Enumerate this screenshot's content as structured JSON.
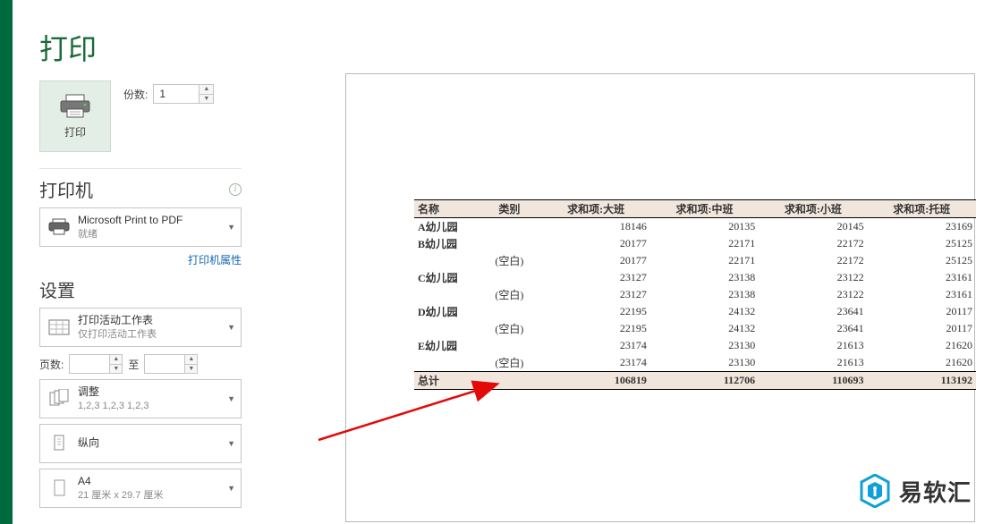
{
  "page": {
    "title": "打印"
  },
  "print_button": {
    "label": "打印"
  },
  "copies": {
    "label": "份数:",
    "value": "1"
  },
  "sections": {
    "printer": "打印机",
    "settings": "设置"
  },
  "printer": {
    "name": "Microsoft Print to PDF",
    "status": "就绪",
    "properties_link": "打印机属性"
  },
  "settings": {
    "scope": {
      "main": "打印活动工作表",
      "sub": "仅打印活动工作表"
    },
    "pages": {
      "label": "页数:",
      "to": "至",
      "from": "",
      "to_val": ""
    },
    "collate": {
      "main": "调整",
      "sub": "1,2,3    1,2,3    1,2,3"
    },
    "orientation": {
      "main": "纵向",
      "sub": ""
    },
    "paper": {
      "main": "A4",
      "sub": "21 厘米 x 29.7 厘米"
    }
  },
  "chart_data": {
    "type": "table",
    "title": "",
    "columns": [
      "名称",
      "类别",
      "求和项:大班",
      "求和项:中班",
      "求和项:小班",
      "求和项:托班"
    ],
    "rows": [
      {
        "name": "A幼儿园",
        "cat": "",
        "v": [
          18146,
          20135,
          20145,
          23169
        ]
      },
      {
        "name": "B幼儿园",
        "cat": "",
        "v": [
          20177,
          22171,
          22172,
          25125
        ]
      },
      {
        "name": "",
        "cat": "(空白)",
        "v": [
          20177,
          22171,
          22172,
          25125
        ]
      },
      {
        "name": "C幼儿园",
        "cat": "",
        "v": [
          23127,
          23138,
          23122,
          23161
        ]
      },
      {
        "name": "",
        "cat": "(空白)",
        "v": [
          23127,
          23138,
          23122,
          23161
        ]
      },
      {
        "name": "D幼儿园",
        "cat": "",
        "v": [
          22195,
          24132,
          23641,
          20117
        ]
      },
      {
        "name": "",
        "cat": "(空白)",
        "v": [
          22195,
          24132,
          23641,
          20117
        ]
      },
      {
        "name": "E幼儿园",
        "cat": "",
        "v": [
          23174,
          23130,
          21613,
          21620
        ]
      },
      {
        "name": "",
        "cat": "(空白)",
        "v": [
          23174,
          23130,
          21613,
          21620
        ]
      }
    ],
    "total": {
      "label": "总计",
      "v": [
        106819,
        112706,
        110693,
        113192
      ]
    }
  },
  "branding": {
    "text": "易软汇"
  }
}
